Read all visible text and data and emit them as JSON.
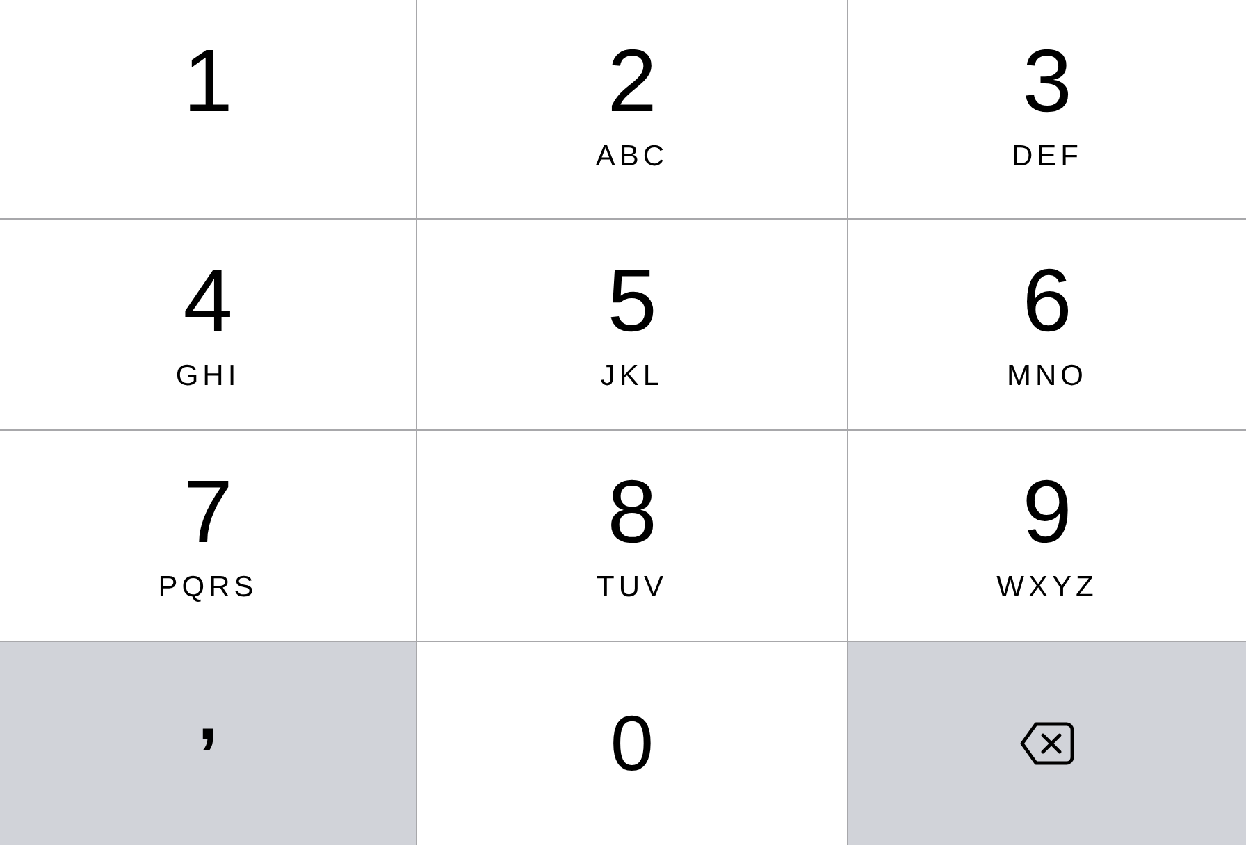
{
  "keypad": {
    "rows": [
      {
        "keys": [
          {
            "kind": "digit",
            "digit": "1"
          },
          {
            "kind": "digit",
            "digit": "2",
            "letters": "ABC"
          },
          {
            "kind": "digit",
            "digit": "3",
            "letters": "DEF"
          }
        ]
      },
      {
        "keys": [
          {
            "kind": "digit",
            "digit": "4",
            "letters": "GHI"
          },
          {
            "kind": "digit",
            "digit": "5",
            "letters": "JKL"
          },
          {
            "kind": "digit",
            "digit": "6",
            "letters": "MNO"
          }
        ]
      },
      {
        "keys": [
          {
            "kind": "digit",
            "digit": "7",
            "letters": "PQRS"
          },
          {
            "kind": "digit",
            "digit": "8",
            "letters": "TUV"
          },
          {
            "kind": "digit",
            "digit": "9",
            "letters": "WXYZ"
          }
        ]
      },
      {
        "keys": [
          {
            "kind": "symbol",
            "symbol": ","
          },
          {
            "kind": "digit",
            "digit": "0"
          },
          {
            "kind": "delete"
          }
        ]
      }
    ]
  }
}
